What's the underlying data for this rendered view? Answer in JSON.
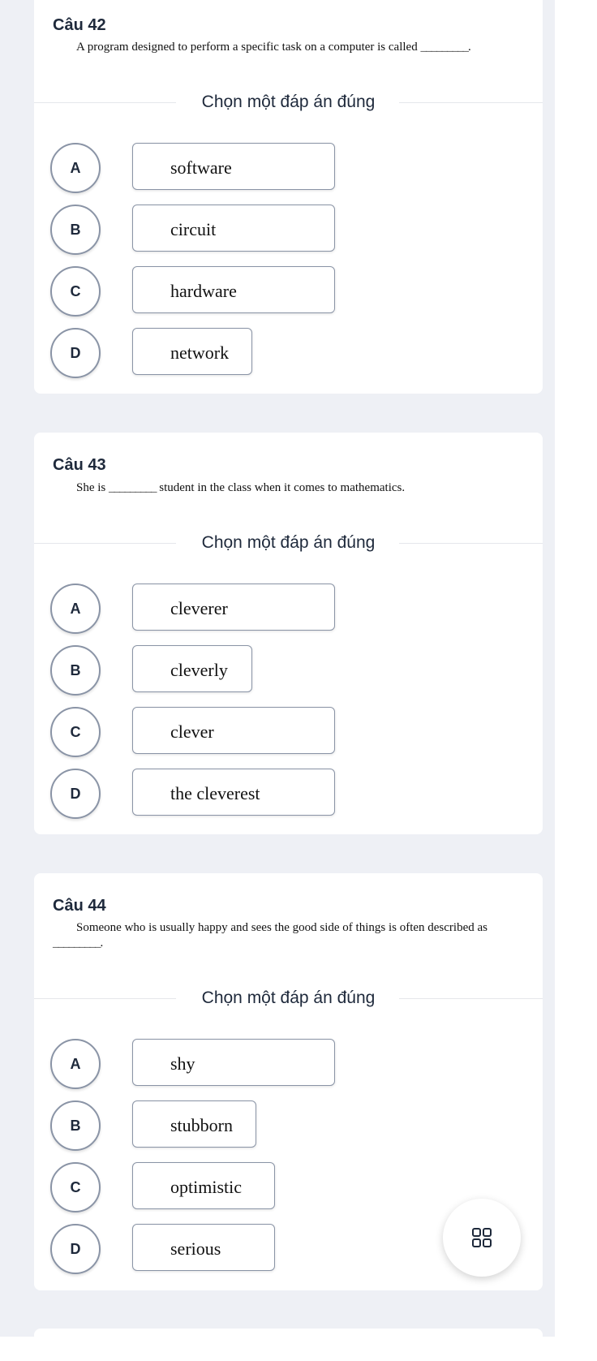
{
  "questions": [
    {
      "title": "Câu 42",
      "text": "A program designed to perform a specific task on a computer is called",
      "text_after": ".",
      "blank": "_________",
      "prompt": "Chọn một đáp án đúng",
      "options": [
        {
          "letter": "A",
          "text": "software"
        },
        {
          "letter": "B",
          "text": "circuit"
        },
        {
          "letter": "C",
          "text": "hardware"
        },
        {
          "letter": "D",
          "text": "network"
        }
      ]
    },
    {
      "title": "Câu 43",
      "text_before": "She is",
      "blank": "_________",
      "text_after": "student in the class when it comes to mathematics.",
      "prompt": "Chọn một đáp án đúng",
      "options": [
        {
          "letter": "A",
          "text": "cleverer"
        },
        {
          "letter": "B",
          "text": "cleverly"
        },
        {
          "letter": "C",
          "text": "clever"
        },
        {
          "letter": "D",
          "text": "the cleverest"
        }
      ]
    },
    {
      "title": "Câu 44",
      "text": "Someone who is usually happy and sees the good side of things is often described as",
      "blank": "_________",
      "text_after": ".",
      "prompt": "Chọn một đáp án đúng",
      "options": [
        {
          "letter": "A",
          "text": "shy"
        },
        {
          "letter": "B",
          "text": "stubborn"
        },
        {
          "letter": "C",
          "text": "optimistic"
        },
        {
          "letter": "D",
          "text": "serious"
        }
      ]
    }
  ],
  "fab": {
    "icon": "grid-icon"
  }
}
